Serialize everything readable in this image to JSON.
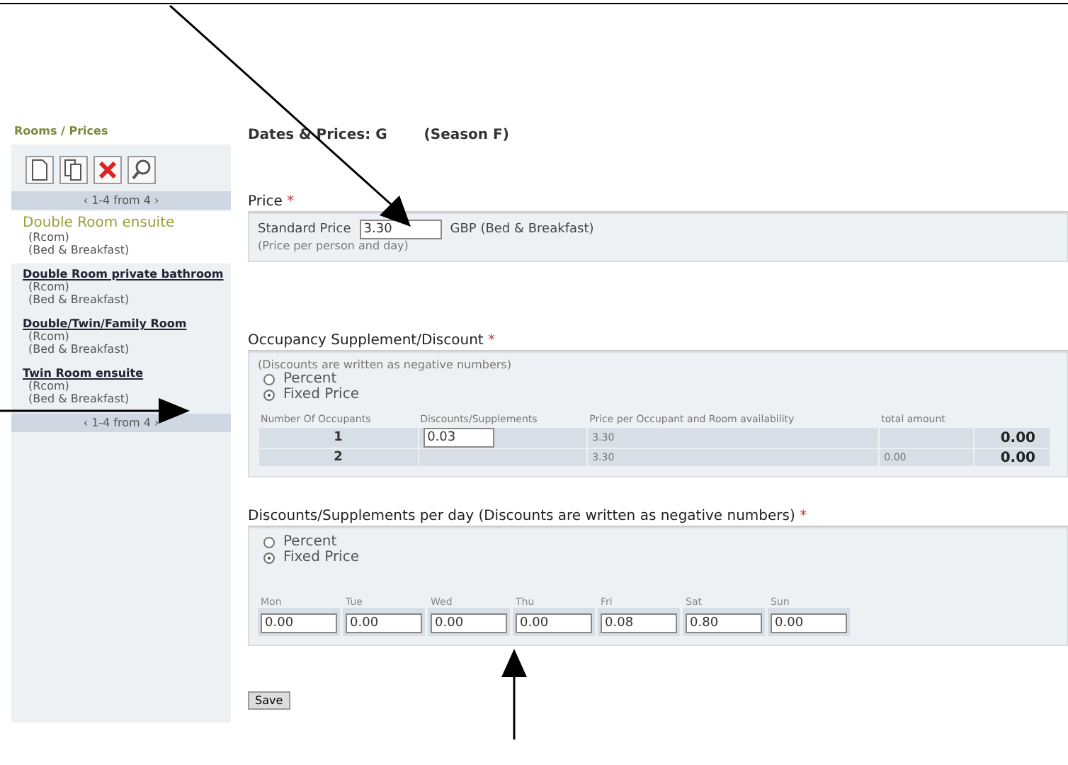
{
  "breadcrumb": "Rooms / Prices",
  "sidebar": {
    "pager_top": "‹ 1-4 from 4 ›",
    "pager_bottom": "‹ 1-4 from 4 ›",
    "items": [
      {
        "name": "Double Room ensuite",
        "code": "(Rcom)",
        "board": "(Bed & Breakfast)",
        "selected": true
      },
      {
        "name": "Double Room private bathroom",
        "code": "(Rcom)",
        "board": "(Bed & Breakfast)",
        "selected": false
      },
      {
        "name": "Double/Twin/Family Room",
        "code": "(Rcom)",
        "board": "(Bed & Breakfast)",
        "selected": false
      },
      {
        "name": "Twin Room ensuite",
        "code": "(Rcom)",
        "board": "(Bed & Breakfast)",
        "selected": false
      }
    ]
  },
  "heading": {
    "title": "Dates & Prices: G",
    "season": "(Season F)"
  },
  "price": {
    "title": "Price",
    "required": "*",
    "label": "Standard Price",
    "value": "3.30",
    "unit": "GBP (Bed & Breakfast)",
    "note": "(Price per person and day)"
  },
  "occupancy": {
    "title": "Occupancy Supplement/Discount",
    "required": "*",
    "note": "(Discounts are written as negative numbers)",
    "options": [
      {
        "label": "Percent",
        "selected": false
      },
      {
        "label": "Fixed Price",
        "selected": true
      }
    ],
    "columns": [
      "Number Of Occupants",
      "Discounts/Supplements",
      "Price per Occupant and Room availability",
      "total amount"
    ],
    "rows": [
      {
        "occupants": "1",
        "discount": "0.03",
        "price": "3.30",
        "availability": "",
        "total": "0.00"
      },
      {
        "occupants": "2",
        "discount": "",
        "price": "3.30",
        "availability": "0.00",
        "total": "0.00"
      }
    ]
  },
  "daily": {
    "title": "Discounts/Supplements per day (Discounts are written as negative numbers)",
    "required": "*",
    "options": [
      {
        "label": "Percent",
        "selected": false
      },
      {
        "label": "Fixed Price",
        "selected": true
      }
    ],
    "days": [
      {
        "label": "Mon",
        "value": "0.00"
      },
      {
        "label": "Tue",
        "value": "0.00"
      },
      {
        "label": "Wed",
        "value": "0.00"
      },
      {
        "label": "Thu",
        "value": "0.00"
      },
      {
        "label": "Fri",
        "value": "0.08"
      },
      {
        "label": "Sat",
        "value": "0.80"
      },
      {
        "label": "Sun",
        "value": "0.00"
      }
    ]
  },
  "save_button": "Save"
}
